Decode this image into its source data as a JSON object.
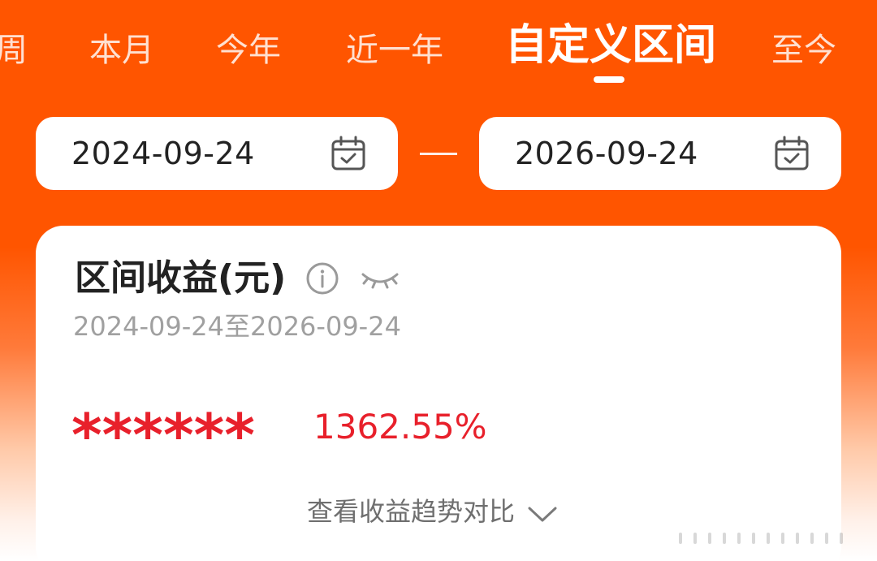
{
  "tabs": [
    {
      "label": "周"
    },
    {
      "label": "本月"
    },
    {
      "label": "今年"
    },
    {
      "label": "近一年"
    },
    {
      "label": "自定义区间"
    },
    {
      "label": "至今"
    }
  ],
  "active_tab": "自定义区间",
  "date_range": {
    "start": "2024-09-24",
    "end": "2026-09-24",
    "separator": "—"
  },
  "card": {
    "title": "区间收益(元)",
    "range_text": "2024-09-24至2026-09-24",
    "masked_amount": "******",
    "return_rate": "1362.55%",
    "trend_link": "查看收益趋势对比"
  },
  "colors": {
    "brand": "#FF5500",
    "positive": "#E8202B"
  },
  "icons": {
    "calendar": "calendar-check-icon",
    "info": "info-icon",
    "hide": "eye-closed-icon",
    "chevron": "chevron-down-icon"
  }
}
